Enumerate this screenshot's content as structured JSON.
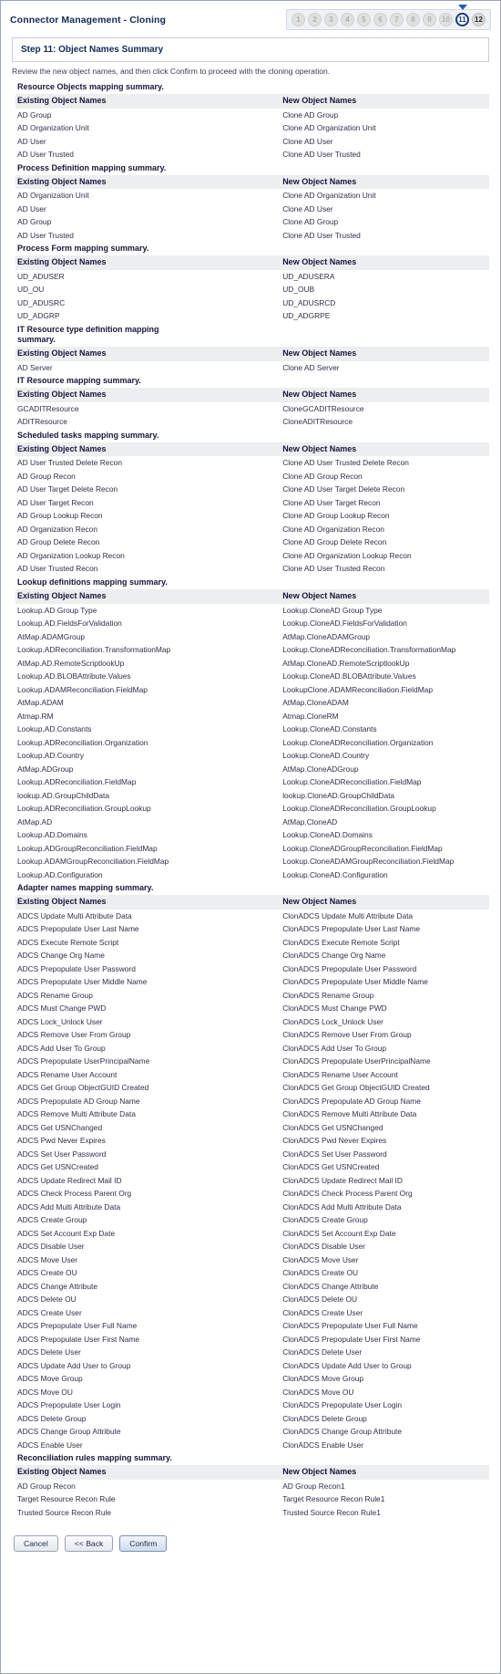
{
  "header": {
    "title": "Connector Management - Cloning",
    "steps": [
      "1",
      "2",
      "3",
      "4",
      "5",
      "6",
      "7",
      "8",
      "9",
      "10",
      "11",
      "12"
    ],
    "current_step": "11",
    "next_step": "12"
  },
  "step_bar": {
    "title": "Step 11: Object Names Summary"
  },
  "instructions": "Review the new object names, and then click Confirm to proceed with the cloning operation.",
  "columns": {
    "existing": "Existing Object Names",
    "new": "New Object Names"
  },
  "sections": [
    {
      "title": "Resource Objects mapping summary.",
      "rows": [
        [
          "AD Group",
          "Clone AD Group"
        ],
        [
          "AD Organization Unit",
          "Clone AD Organization Unit"
        ],
        [
          "AD User",
          "Clone AD User"
        ],
        [
          "AD User Trusted",
          "Clone AD User Trusted"
        ]
      ]
    },
    {
      "title": "Process Definition mapping summary.",
      "rows": [
        [
          "AD Organization Unit",
          "Clone AD Organization Unit"
        ],
        [
          "AD User",
          "Clone AD User"
        ],
        [
          "AD Group",
          "Clone AD Group"
        ],
        [
          "AD User Trusted",
          "Clone AD User Trusted"
        ]
      ]
    },
    {
      "title": "Process Form mapping summary.",
      "rows": [
        [
          "UD_ADUSER",
          "UD_ADUSERA"
        ],
        [
          "UD_OU",
          "UD_OUB"
        ],
        [
          "UD_ADUSRC",
          "UD_ADUSRCD"
        ],
        [
          "UD_ADGRP",
          "UD_ADGRPE"
        ]
      ]
    },
    {
      "title": "IT Resource type definition mapping summary.",
      "two_line": true,
      "rows": [
        [
          "AD Server",
          "Clone AD Server"
        ]
      ]
    },
    {
      "title": "IT Resource mapping summary.",
      "rows": [
        [
          "GCADITResource",
          "CloneGCADITResource"
        ],
        [
          "ADITResource",
          "CloneADITResource"
        ]
      ]
    },
    {
      "title": "Scheduled tasks mapping summary.",
      "rows": [
        [
          "AD User Trusted Delete Recon",
          "Clone AD User Trusted Delete Recon"
        ],
        [
          "AD Group Recon",
          "Clone AD Group Recon"
        ],
        [
          "AD User Target Delete Recon",
          "Clone AD User Target Delete Recon"
        ],
        [
          "AD User Target Recon",
          "Clone AD User Target Recon"
        ],
        [
          "AD Group Lookup Recon",
          "Clone AD Group Lookup Recon"
        ],
        [
          "AD Organization Recon",
          "Clone AD Organization Recon"
        ],
        [
          "AD Group Delete Recon",
          "Clone AD Group Delete Recon"
        ],
        [
          "AD Organization Lookup Recon",
          "Clone AD Organization Lookup Recon"
        ],
        [
          "AD User Trusted Recon",
          "Clone AD User Trusted Recon"
        ]
      ]
    },
    {
      "title": "Lookup definitions mapping summary.",
      "rows": [
        [
          "Lookup.AD Group Type",
          "Lookup.CloneAD Group Type"
        ],
        [
          "Lookup.AD.FieldsForValidation",
          "Lookup.CloneAD.FieldsForValidation"
        ],
        [
          "AtMap.ADAMGroup",
          "AtMap.CloneADAMGroup"
        ],
        [
          "Lookup.ADReconciliation.TransformationMap",
          "Lookup.CloneADReconciliation.TransformationMap"
        ],
        [
          "AtMap.AD.RemoteScriptlookUp",
          "AtMap.CloneAD.RemoteScriptlookUp"
        ],
        [
          "Lookup.AD.BLOBAttribute.Values",
          "Lookup.CloneAD.BLOBAttribute.Values"
        ],
        [
          "Lookup.ADAMReconciliation.FieldMap",
          "LookupClone.ADAMReconciliation.FieldMap"
        ],
        [
          "AtMap.ADAM",
          "AtMap.CloneADAM"
        ],
        [
          "Atmap.RM",
          "Atmap.CloneRM"
        ],
        [
          "Lookup.AD.Constants",
          "Lookup.CloneAD.Constants"
        ],
        [
          "Lookup.ADReconciliation.Organization",
          "Lookup.CloneADReconciliation.Organization"
        ],
        [
          "Lookup.AD.Country",
          "Lookup.CloneAD.Country"
        ],
        [
          "AtMap.ADGroup",
          "AtMap.CloneADGroup"
        ],
        [
          "Lookup.ADReconciliation.FieldMap",
          "Lookup.CloneADReconciliation.FieldMap"
        ],
        [
          "lookup.AD.GroupChildData",
          "lookup.CloneAD.GroupChildData"
        ],
        [
          "Lookup.ADReconciliation.GroupLookup",
          "Lookup.CloneADReconciliation.GroupLookup"
        ],
        [
          "AtMap.AD",
          "AtMap.CloneAD"
        ],
        [
          "Lookup.AD.Domains",
          "Lookup.CloneAD.Domains"
        ],
        [
          "Lookup.ADGroupReconciliation.FieldMap",
          "Lookup.CloneADGroupReconciliation.FieldMap"
        ],
        [
          "Lookup.ADAMGroupReconciliation.FieldMap",
          "Lookup.CloneADAMGroupReconciliation.FieldMap"
        ],
        [
          "Lookup.AD.Configuration",
          "Lookup.CloneAD.Configuration"
        ]
      ]
    },
    {
      "title": "Adapter names mapping summary.",
      "rows": [
        [
          "ADCS Update Multi Attribute Data",
          "ClonADCS Update Multi Attribute Data"
        ],
        [
          "ADCS Prepopulate User Last Name",
          "ClonADCS Prepopulate User Last Name"
        ],
        [
          "ADCS Execute Remote Script",
          "ClonADCS Execute Remote Script"
        ],
        [
          "ADCS Change Org Name",
          "ClonADCS Change Org Name"
        ],
        [
          "ADCS Prepopulate User Password",
          "ClonADCS Prepopulate User Password"
        ],
        [
          "ADCS Prepopulate User Middle Name",
          "ClonADCS Prepopulate User Middle Name"
        ],
        [
          "ADCS Rename Group",
          "ClonADCS Rename Group"
        ],
        [
          "ADCS Must Change PWD",
          "ClonADCS Must Change PWD"
        ],
        [
          "ADCS Lock_Unlock User",
          "ClonADCS Lock_Unlock User"
        ],
        [
          "ADCS Remove User From Group",
          "ClonADCS Remove User From Group"
        ],
        [
          "ADCS Add User To Group",
          "ClonADCS Add User To Group"
        ],
        [
          "ADCS Prepopulate UserPrincipalName",
          "ClonADCS Prepopulate UserPrincipalName"
        ],
        [
          "ADCS Rename User Account",
          "ClonADCS Rename User Account"
        ],
        [
          "ADCS Get Group ObjectGUID Created",
          "ClonADCS Get Group ObjectGUID Created"
        ],
        [
          "ADCS Prepopulate AD Group Name",
          "ClonADCS Prepopulate AD Group Name"
        ],
        [
          "ADCS Remove Multi Attribute Data",
          "ClonADCS Remove Multi Attribute Data"
        ],
        [
          "ADCS Get USNChanged",
          "ClonADCS Get USNChanged"
        ],
        [
          "ADCS Pwd Never Expires",
          "ClonADCS Pwd Never Expires"
        ],
        [
          "ADCS Set User Password",
          "ClonADCS Set User Password"
        ],
        [
          "ADCS Get USNCreated",
          "ClonADCS Get USNCreated"
        ],
        [
          "ADCS Update Redirect Mail ID",
          "ClonADCS Update Redirect Mail ID"
        ],
        [
          "ADCS Check Process Parent Org",
          "ClonADCS Check Process Parent Org"
        ],
        [
          "ADCS Add Multi Attribute Data",
          "ClonADCS Add Multi Attribute Data"
        ],
        [
          "ADCS Create Group",
          "ClonADCS Create Group"
        ],
        [
          "ADCS Set Account Exp Date",
          "ClonADCS Set Account Exp Date"
        ],
        [
          "ADCS Disable User",
          "ClonADCS Disable User"
        ],
        [
          "ADCS Move User",
          "ClonADCS Move User"
        ],
        [
          "ADCS Create OU",
          "ClonADCS Create OU"
        ],
        [
          "ADCS Change Attribute",
          "ClonADCS Change Attribute"
        ],
        [
          "ADCS Delete OU",
          "ClonADCS Delete OU"
        ],
        [
          "ADCS Create User",
          "ClonADCS Create User"
        ],
        [
          "ADCS Prepopulate User Full Name",
          "ClonADCS Prepopulate User Full Name"
        ],
        [
          "ADCS Prepopulate User First Name",
          "ClonADCS Prepopulate User First Name"
        ],
        [
          "ADCS Delete User",
          "ClonADCS Delete User"
        ],
        [
          "ADCS Update Add User to Group",
          "ClonADCS Update Add User to Group"
        ],
        [
          "ADCS Move Group",
          "ClonADCS Move Group"
        ],
        [
          "ADCS Move OU",
          "ClonADCS Move OU"
        ],
        [
          "ADCS Prepopulate User Login",
          "ClonADCS Prepopulate User Login"
        ],
        [
          "ADCS Delete Group",
          "ClonADCS Delete Group"
        ],
        [
          "ADCS Change Group Attribute",
          "ClonADCS Change Group Attribute"
        ],
        [
          "ADCS Enable User",
          "ClonADCS Enable User"
        ]
      ]
    },
    {
      "title": "Reconciliation rules mapping summary.",
      "rows": [
        [
          "AD Group Recon",
          "AD Group Recon1"
        ],
        [
          "Target Resource Recon Rule",
          "Target Resource Recon Rule1"
        ],
        [
          "Trusted Source Recon Rule",
          "Trusted Source Recon Rule1"
        ]
      ]
    }
  ],
  "footer": {
    "cancel": "Cancel",
    "back": "<< Back",
    "confirm": "Confirm"
  }
}
